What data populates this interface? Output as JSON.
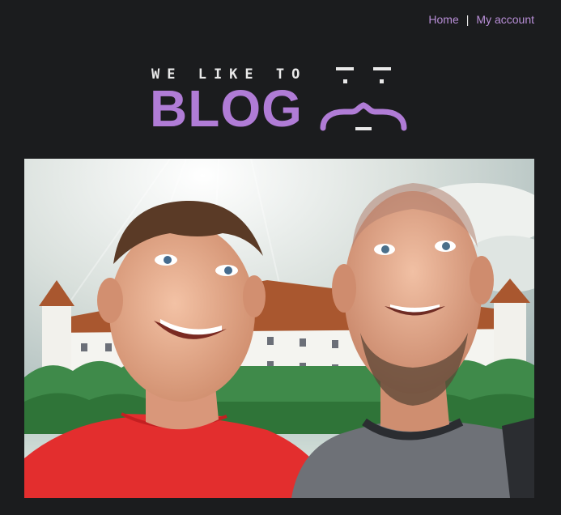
{
  "nav": {
    "home_label": "Home",
    "separator": "|",
    "account_label": "My account"
  },
  "logo": {
    "tagline": "WE LIKE TO",
    "wordmark": "BLOG",
    "accent_color": "#b07cd6"
  },
  "hero": {
    "image": "photo-illustration-two-men-castle"
  }
}
